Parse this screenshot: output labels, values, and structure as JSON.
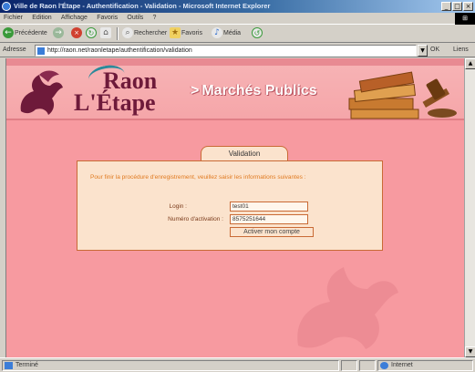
{
  "window": {
    "title": "Ville de Raon l'Étape - Authentification - Validation - Microsoft Internet Explorer",
    "buttons": {
      "minimize": "_",
      "maximize": "□",
      "close": "×"
    }
  },
  "menu": {
    "items": [
      "Fichier",
      "Edition",
      "Affichage",
      "Favoris",
      "Outils",
      "?"
    ]
  },
  "toolbar": {
    "back": "Précédente",
    "forward": "→",
    "search": "Rechercher",
    "favorites": "Favoris",
    "media": "Média"
  },
  "address": {
    "label": "Adresse",
    "url": "http://raon.net/raonletape/authentification/validation",
    "go": "OK",
    "links": "Liens"
  },
  "banner": {
    "logo_line1": "Raon",
    "logo_line2": "L'Étape",
    "site_section": "Marchés Publics",
    "chevron": ">"
  },
  "form": {
    "tab_label": "Validation",
    "message": "Pour finir la procédure d'enregistrement, veuillez saisir les informations suivantes :",
    "login_label": "Login :",
    "login_value": "test01",
    "code_label": "Numéro d'activation :",
    "code_value": "8575251644",
    "submit_label": "Activer mon compte"
  },
  "status": {
    "left": "Terminé",
    "zone": "Internet"
  },
  "colors": {
    "page_bg": "#f79aa0",
    "panel_bg": "#fbe3cd",
    "panel_border": "#c96a35",
    "logo_text": "#6e1a3a",
    "message_text": "#e07a20"
  }
}
